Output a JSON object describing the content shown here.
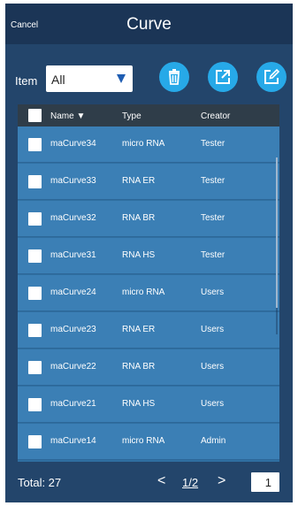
{
  "header": {
    "cancel_label": "Cancel",
    "title": "Curve"
  },
  "filter": {
    "label": "Item",
    "selected": "All"
  },
  "actions": [
    {
      "icon": "trash-icon",
      "color": "#27a9e8"
    },
    {
      "icon": "export-icon",
      "color": "#27a9e8"
    },
    {
      "icon": "edit-icon",
      "color": "#27a9e8"
    }
  ],
  "table": {
    "columns": {
      "name": "Name",
      "type": "Type",
      "creator": "Creator"
    },
    "rows": [
      {
        "name": "maCurve34",
        "type": "micro RNA",
        "creator": "Tester"
      },
      {
        "name": "maCurve33",
        "type": "RNA ER",
        "creator": "Tester"
      },
      {
        "name": "maCurve32",
        "type": "RNA BR",
        "creator": "Tester"
      },
      {
        "name": "maCurve31",
        "type": "RNA HS",
        "creator": "Tester"
      },
      {
        "name": "maCurve24",
        "type": "micro RNA",
        "creator": "Users"
      },
      {
        "name": "maCurve23",
        "type": "RNA ER",
        "creator": "Users"
      },
      {
        "name": "maCurve22",
        "type": "RNA BR",
        "creator": "Users"
      },
      {
        "name": "maCurve21",
        "type": "RNA HS",
        "creator": "Users"
      },
      {
        "name": "maCurve14",
        "type": "micro RNA",
        "creator": "Admin"
      }
    ]
  },
  "footer": {
    "total_label": "Total: 27",
    "prev": "<",
    "page_label": "1/2",
    "next": ">",
    "page_input": "1"
  },
  "colors": {
    "accent": "#27a9e8",
    "header_bg": "#1b3556",
    "row_bg": "#3b7fb5",
    "table_header_bg": "#2f3d49"
  }
}
